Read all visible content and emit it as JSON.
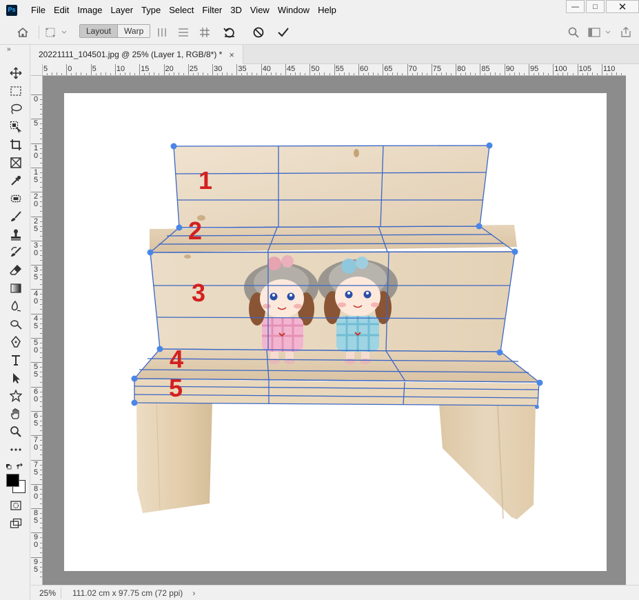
{
  "app": {
    "logo_text": "Ps"
  },
  "menu": [
    "File",
    "Edit",
    "Image",
    "Layer",
    "Type",
    "Select",
    "Filter",
    "3D",
    "View",
    "Window",
    "Help"
  ],
  "window_controls": {
    "minimize": "—",
    "maximize": "□",
    "close": "✕"
  },
  "options_bar": {
    "mode_layout": "Layout",
    "mode_warp": "Warp",
    "icons": [
      "home-icon",
      "puppet-warp-icon",
      "split-vertical-icon",
      "split-horizontal-icon",
      "grid-icon",
      "undo-warp-icon",
      "cancel-icon",
      "commit-icon",
      "search-icon",
      "workspace-icon",
      "share-icon"
    ]
  },
  "toolbar": {
    "collapse_glyph": "»",
    "tools": [
      "move-tool-icon",
      "marquee-tool-icon",
      "lasso-tool-icon",
      "object-select-tool-icon",
      "crop-tool-icon",
      "frame-tool-icon",
      "eyedropper-tool-icon",
      "spot-healing-tool-icon",
      "brush-tool-icon",
      "clone-stamp-tool-icon",
      "history-brush-tool-icon",
      "eraser-tool-icon",
      "gradient-tool-icon",
      "blur-tool-icon",
      "dodge-tool-icon",
      "pen-tool-icon",
      "type-tool-icon",
      "path-select-tool-icon",
      "shape-tool-icon",
      "hand-tool-icon",
      "zoom-tool-icon",
      "more-tools-icon"
    ],
    "foreground_color": "#000000",
    "background_color": "#ffffff"
  },
  "document_tab": {
    "title": "20221111_104501.jpg @ 25% (Layer 1, RGB/8*) *",
    "close": "×"
  },
  "rulers": {
    "horizontal": [
      "5",
      "0",
      "5",
      "10",
      "15",
      "20",
      "25",
      "30",
      "35",
      "40",
      "45",
      "50",
      "55",
      "60",
      "65",
      "70",
      "75",
      "80",
      "85",
      "90",
      "95",
      "100",
      "105",
      "110"
    ],
    "vertical": [
      "0",
      "5",
      "10",
      "15",
      "20",
      "25",
      "30",
      "35",
      "40",
      "45",
      "50",
      "55",
      "60",
      "65",
      "70",
      "75",
      "80",
      "85",
      "90",
      "95"
    ]
  },
  "canvas": {
    "annotations": [
      "1",
      "2",
      "3",
      "4",
      "5"
    ],
    "annotation_color": "#d32020",
    "mesh_color": "#3a66c4",
    "handle_color": "#4a86e8"
  },
  "status": {
    "zoom": "25%",
    "doc_info": "111.02 cm x 97.75 cm (72 ppi)",
    "arrow": "›"
  }
}
